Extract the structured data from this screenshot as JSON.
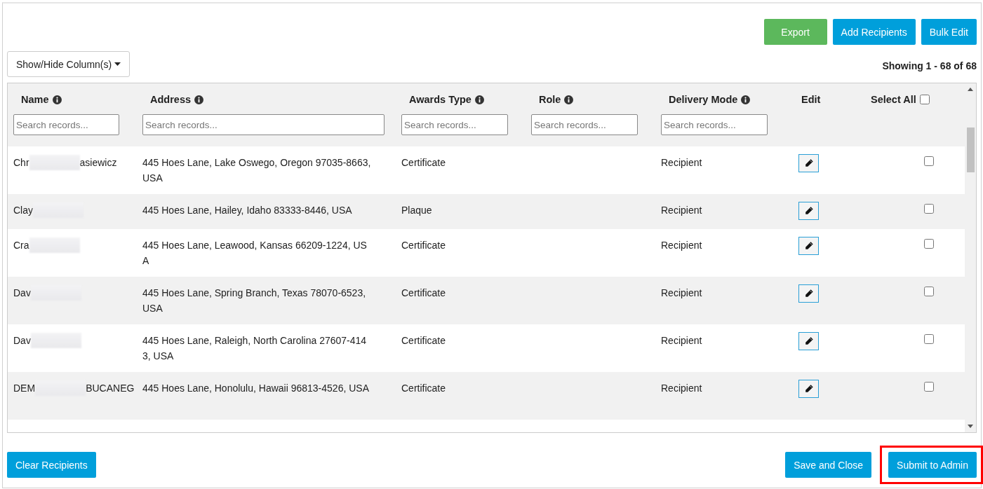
{
  "toolbar": {
    "buttons": [
      {
        "label": "Export",
        "kind": "success"
      },
      {
        "label": "Add Recipients",
        "kind": "primary"
      },
      {
        "label": "Bulk Edit",
        "kind": "primary"
      }
    ]
  },
  "column_toggle": {
    "label": "Show/Hide Column(s)"
  },
  "summary": "Showing 1 - 68 of 68",
  "table": {
    "columns": [
      {
        "label": "Name",
        "info": true,
        "placeholder": "Search records..."
      },
      {
        "label": "Address",
        "info": true,
        "placeholder": "Search records..."
      },
      {
        "label": "Awards Type",
        "info": true,
        "placeholder": "Search records..."
      },
      {
        "label": "Role",
        "info": true,
        "placeholder": "Search records..."
      },
      {
        "label": "Delivery Mode",
        "info": true,
        "placeholder": "Search records..."
      },
      {
        "label": "Edit",
        "info": false
      },
      {
        "label": "Select All",
        "info": false,
        "select_all": {
          "checked": false
        }
      }
    ],
    "rows": [
      {
        "name_start": "Chr",
        "redacted": true,
        "name_end": "asiewicz",
        "address": "445 Hoes Lane, Lake Oswego, Oregon 97035-8663, USA",
        "awards_type": "Certificate",
        "delivery_mode": "Recipient",
        "checked": false
      },
      {
        "name_start": "Clay",
        "redacted": true,
        "address": "445 Hoes Lane, Hailey, Idaho 83333-8446, USA",
        "awards_type": "Plaque",
        "delivery_mode": "Recipient",
        "checked": false
      },
      {
        "name_start": "Cra",
        "redacted": true,
        "address": "445 Hoes Lane, Leawood, Kansas 66209-1224, USA",
        "awards_type": "Certificate",
        "delivery_mode": "Recipient",
        "checked": false
      },
      {
        "name_start": "Dav",
        "redacted": true,
        "address": "445 Hoes Lane, Spring Branch, Texas 78070-6523, USA",
        "awards_type": "Certificate",
        "delivery_mode": "Recipient",
        "checked": false
      },
      {
        "name_start": "Dav",
        "redacted": true,
        "address": "445 Hoes Lane, Raleigh, North Carolina 27607-4143, USA",
        "awards_type": "Certificate",
        "delivery_mode": "Recipient",
        "checked": false
      },
      {
        "name_start": "DEM",
        "redacted": true,
        "name_end": "BUCANEG",
        "address": "445 Hoes Lane, Honolulu, Hawaii 96813-4526, USA",
        "awards_type": "Certificate",
        "delivery_mode": "Recipient",
        "checked": false
      }
    ]
  },
  "footer": {
    "left_buttons": [
      {
        "label": "Clear Recipients"
      }
    ],
    "right_buttons": [
      {
        "label": "Save and Close",
        "highlighted": false
      },
      {
        "label": "Submit to Admin",
        "highlighted": true
      }
    ]
  }
}
